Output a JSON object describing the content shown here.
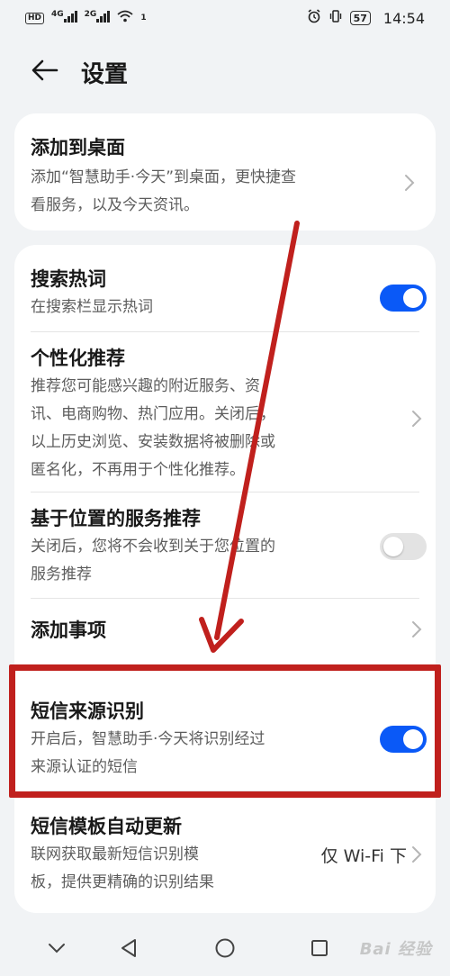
{
  "status_bar": {
    "hd_badge": "HD",
    "sim1": "4G",
    "sim2": "2G",
    "wifi_sup": "1",
    "battery": "57",
    "time": "14:54"
  },
  "header": {
    "title": "设置",
    "back_icon": "arrow-left-icon"
  },
  "card1": {
    "title": "添加到桌面",
    "subtitle_line1": "添加“智慧助手·今天”到桌面，更快捷查",
    "subtitle_line2": "看服务，以及今天资讯。"
  },
  "settings": [
    {
      "title": "搜索热词",
      "subtitle": [
        "在搜索栏显示热词"
      ],
      "control": "toggle",
      "on": true
    },
    {
      "title": "个性化推荐",
      "subtitle": [
        "推荐您可能感兴趣的附近服务、资",
        "讯、电商购物、热门应用。关闭后，",
        "以上历史浏览、安装数据将被删除或",
        "匿名化，不再用于个性化推荐。"
      ],
      "control": "chevron"
    },
    {
      "title": "基于位置的服务推荐",
      "subtitle": [
        "关闭后，您将不会收到关于您位置的",
        "服务推荐"
      ],
      "control": "toggle",
      "on": false
    },
    {
      "title": "添加事项",
      "subtitle": [],
      "control": "chevron"
    },
    {
      "title": "短信来源识别",
      "subtitle": [
        "开启后，智慧助手·今天将识别经过",
        "来源认证的短信"
      ],
      "control": "toggle",
      "on": true
    },
    {
      "title": "短信模板自动更新",
      "subtitle": [
        "联网获取最新短信识别模",
        "板，提供更精确的识别结果"
      ],
      "control": "chevron",
      "value": "仅 Wi-Fi 下"
    }
  ],
  "colors": {
    "accent": "#0a59f7",
    "highlight": "#c0201d",
    "background": "#f1f3f5"
  },
  "watermark": "Bai 经验"
}
